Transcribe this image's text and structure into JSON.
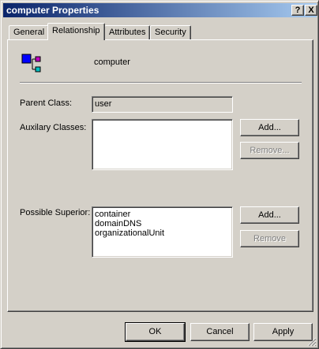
{
  "window": {
    "title": "computer Properties"
  },
  "titlebar_buttons": {
    "help": "?",
    "close": "X"
  },
  "tabs": [
    {
      "label": "General"
    },
    {
      "label": "Relationship"
    },
    {
      "label": "Attributes"
    },
    {
      "label": "Security"
    }
  ],
  "active_tab": "Relationship",
  "object": {
    "name": "computer",
    "icon": "class-schema-icon"
  },
  "parent_class": {
    "label": "Parent Class:",
    "value": "user"
  },
  "auxiliary_classes": {
    "label": "Auxilary Classes:",
    "items": [],
    "add_label": "Add...",
    "remove_label": "Remove..."
  },
  "possible_superior": {
    "label": "Possible Superior:",
    "items": [
      "container",
      "domainDNS",
      "organizationalUnit"
    ],
    "add_label": "Add...",
    "remove_label": "Remove"
  },
  "footer": {
    "ok_label": "OK",
    "cancel_label": "Cancel",
    "apply_label": "Apply"
  },
  "colors": {
    "titlebar_start": "#0a246a",
    "titlebar_end": "#a6caf0",
    "face": "#d4d0c8"
  }
}
